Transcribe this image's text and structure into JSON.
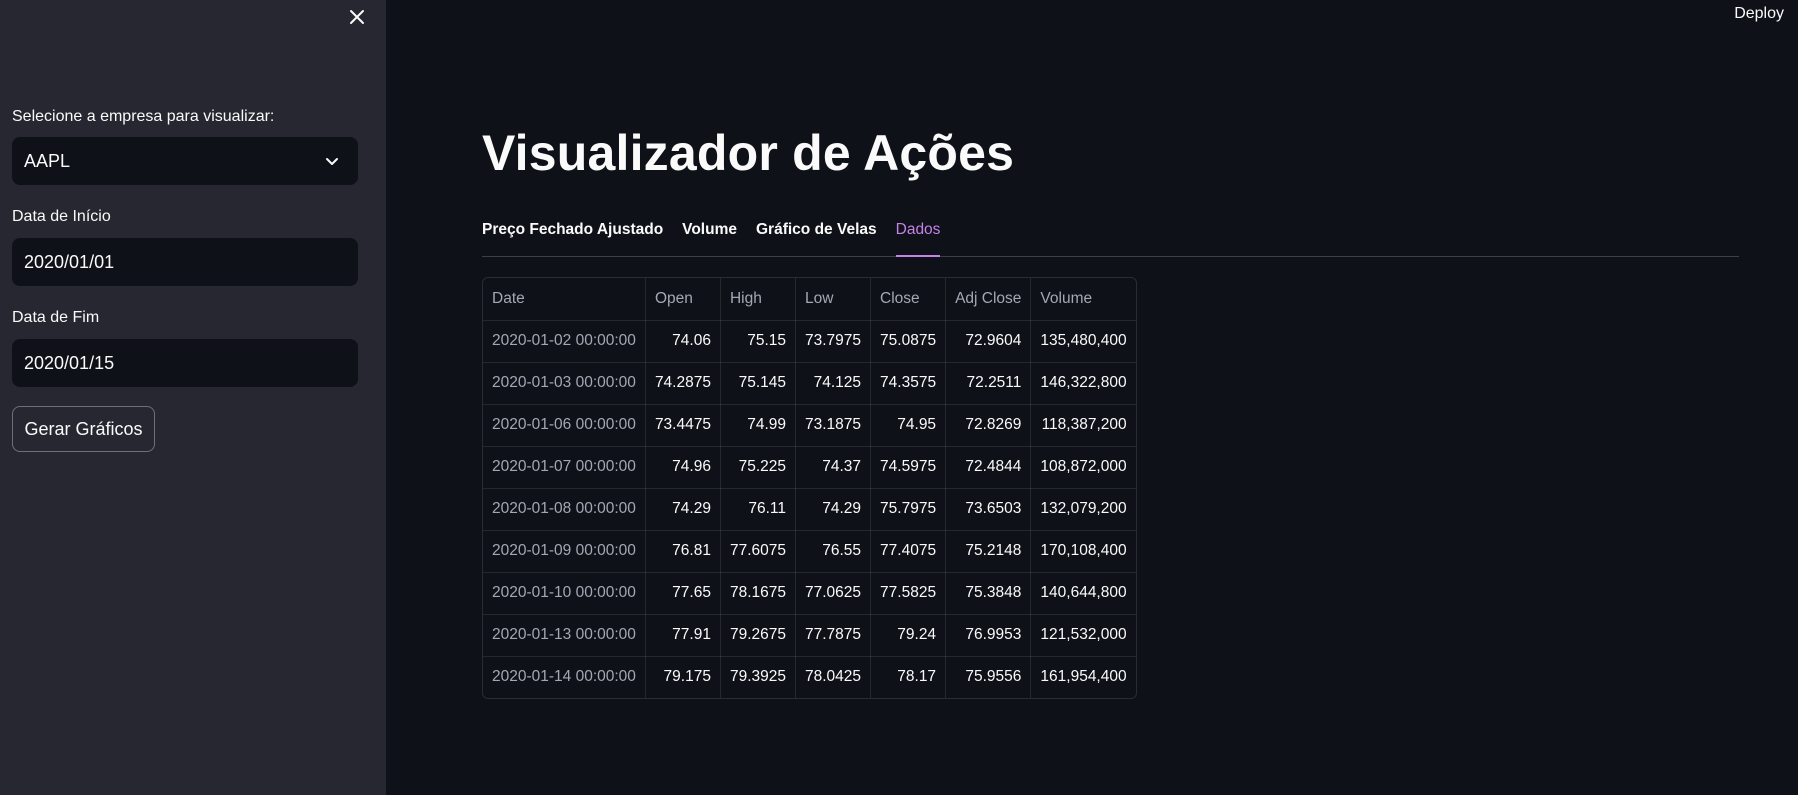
{
  "header": {
    "deploy_label": "Deploy"
  },
  "sidebar": {
    "company_label": "Selecione a empresa para visualizar:",
    "company_value": "AAPL",
    "start_label": "Data de Início",
    "start_value": "2020/01/01",
    "end_label": "Data de Fim",
    "end_value": "2020/01/15",
    "generate_button": "Gerar Gráficos",
    "close_icon": "close-icon"
  },
  "main": {
    "title": "Visualizador de Ações",
    "tabs": [
      {
        "label": "Preço Fechado Ajustado",
        "active": false
      },
      {
        "label": "Volume",
        "active": false
      },
      {
        "label": "Gráfico de Velas",
        "active": false
      },
      {
        "label": "Dados",
        "active": true
      }
    ],
    "table": {
      "columns": [
        "Date",
        "Open",
        "High",
        "Low",
        "Close",
        "Adj Close",
        "Volume"
      ],
      "rows": [
        [
          "2020-01-02 00:00:00",
          "74.06",
          "75.15",
          "73.7975",
          "75.0875",
          "72.9604",
          "135,480,400"
        ],
        [
          "2020-01-03 00:00:00",
          "74.2875",
          "75.145",
          "74.125",
          "74.3575",
          "72.2511",
          "146,322,800"
        ],
        [
          "2020-01-06 00:00:00",
          "73.4475",
          "74.99",
          "73.1875",
          "74.95",
          "72.8269",
          "118,387,200"
        ],
        [
          "2020-01-07 00:00:00",
          "74.96",
          "75.225",
          "74.37",
          "74.5975",
          "72.4844",
          "108,872,000"
        ],
        [
          "2020-01-08 00:00:00",
          "74.29",
          "76.11",
          "74.29",
          "75.7975",
          "73.6503",
          "132,079,200"
        ],
        [
          "2020-01-09 00:00:00",
          "76.81",
          "77.6075",
          "76.55",
          "77.4075",
          "75.2148",
          "170,108,400"
        ],
        [
          "2020-01-10 00:00:00",
          "77.65",
          "78.1675",
          "77.0625",
          "77.5825",
          "75.3848",
          "140,644,800"
        ],
        [
          "2020-01-13 00:00:00",
          "77.91",
          "79.2675",
          "77.7875",
          "79.24",
          "76.9953",
          "121,532,000"
        ],
        [
          "2020-01-14 00:00:00",
          "79.175",
          "79.3925",
          "78.0425",
          "78.17",
          "75.9556",
          "161,954,400"
        ]
      ]
    }
  },
  "colors": {
    "background": "#0e1117",
    "sidebar": "#262730",
    "accent": "#c582e8",
    "text": "#fafafa",
    "muted_text": "#a3a8b4"
  }
}
